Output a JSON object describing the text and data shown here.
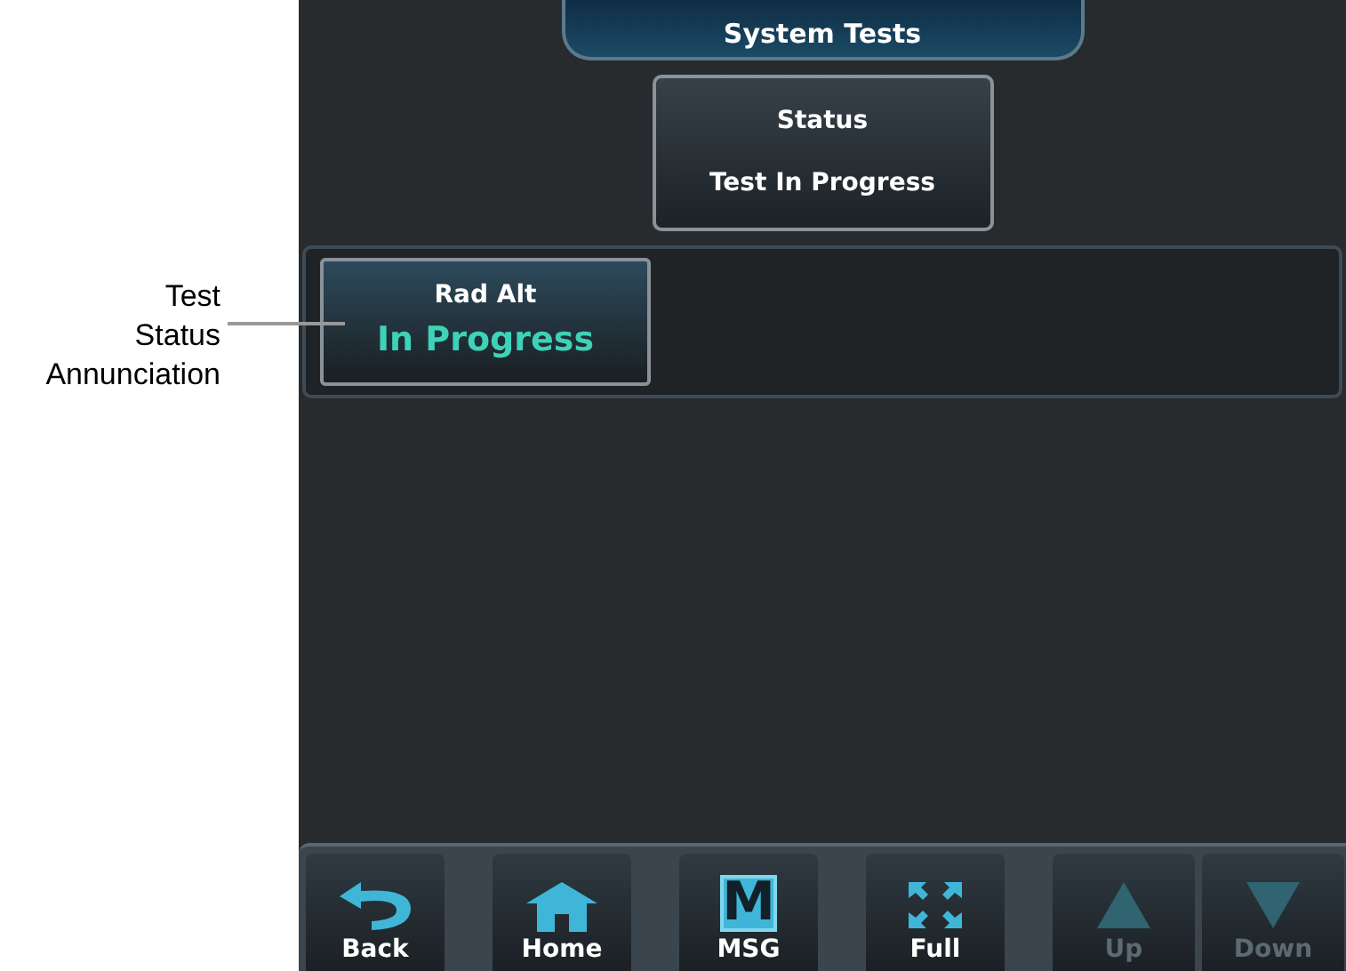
{
  "callout": {
    "lines": [
      "Test",
      "Status",
      "Annunciation"
    ]
  },
  "screen": {
    "title": "System Tests",
    "status": {
      "label": "Status",
      "value": "Test In Progress"
    },
    "tests": [
      {
        "name": "Rad Alt",
        "status": "In Progress"
      }
    ]
  },
  "buttons": [
    {
      "kind": "back",
      "label": "Back",
      "disabled": false
    },
    {
      "kind": "home",
      "label": "Home",
      "disabled": false
    },
    {
      "kind": "msg",
      "label": "MSG",
      "glyph": "M",
      "disabled": false
    },
    {
      "kind": "full",
      "label": "Full",
      "disabled": false
    },
    {
      "kind": "up",
      "label": "Up",
      "disabled": true
    },
    {
      "kind": "down",
      "label": "Down",
      "disabled": true
    }
  ]
}
